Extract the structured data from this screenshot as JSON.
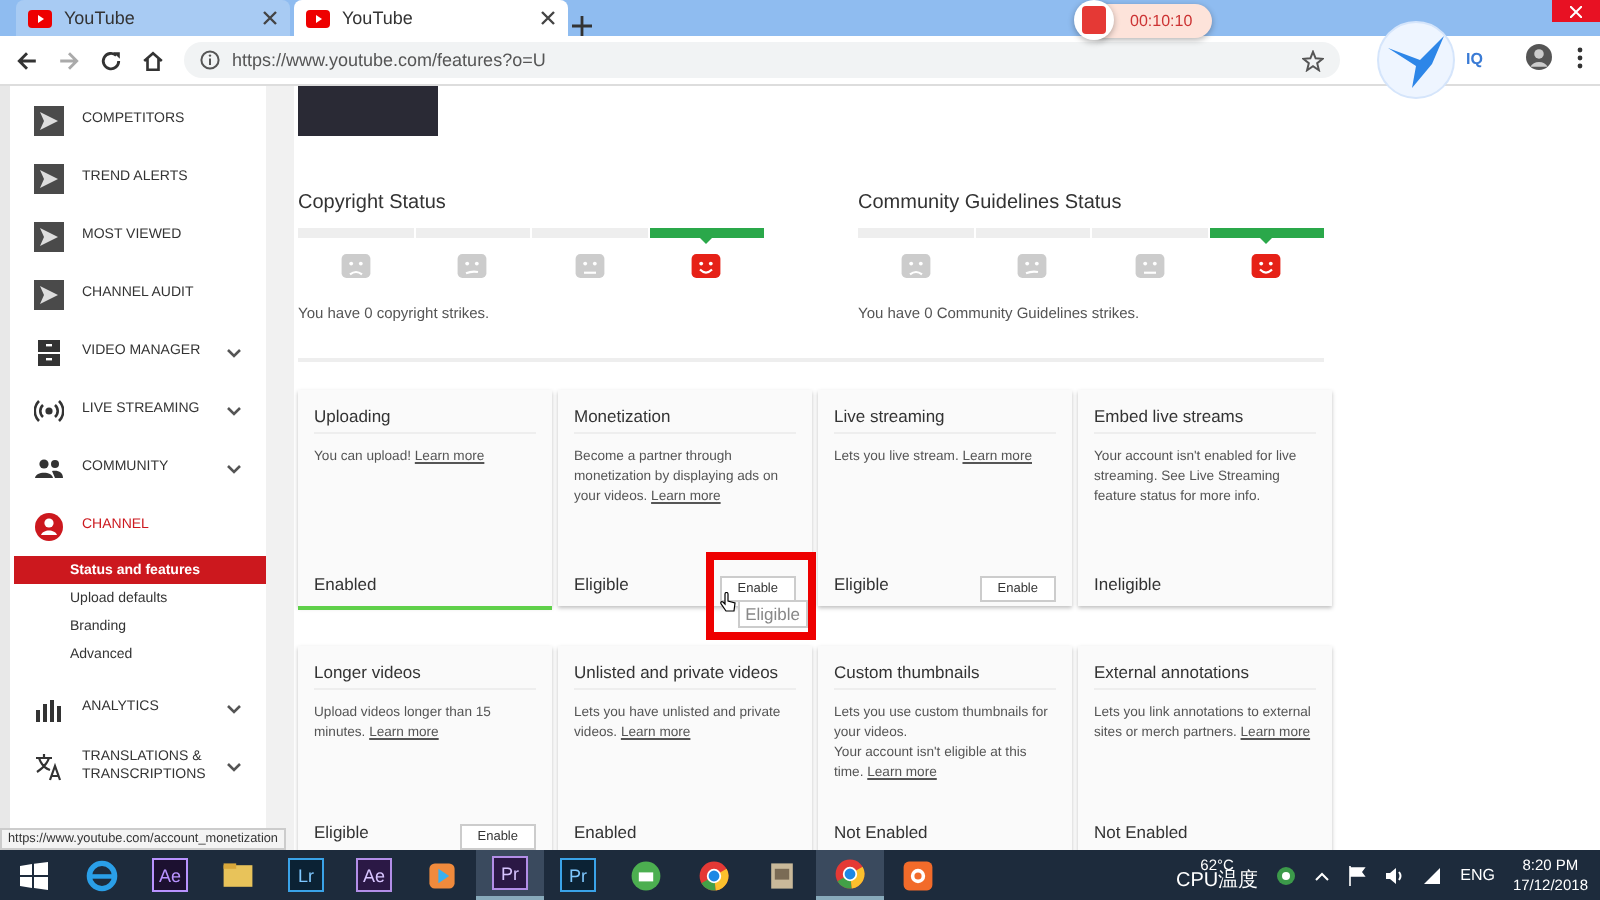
{
  "browser": {
    "tabs": [
      {
        "title": "YouTube",
        "selected": false
      },
      {
        "title": "YouTube",
        "selected": true
      }
    ],
    "url": "https://www.youtube.com/features?o=U",
    "recorder_time": "00:10:10",
    "extension_label": "IQ"
  },
  "sidebar": {
    "items": [
      {
        "kind": "tool",
        "label": "COMPETITORS"
      },
      {
        "kind": "tool",
        "label": "TREND ALERTS"
      },
      {
        "kind": "tool",
        "label": "MOST VIEWED"
      },
      {
        "kind": "tool",
        "label": "CHANNEL AUDIT"
      },
      {
        "kind": "menu",
        "label": "VIDEO MANAGER",
        "expanded": false
      },
      {
        "kind": "menu",
        "label": "LIVE STREAMING",
        "expanded": false
      },
      {
        "kind": "menu",
        "label": "COMMUNITY",
        "expanded": false
      },
      {
        "kind": "menu",
        "label": "CHANNEL",
        "expanded": true,
        "children": [
          {
            "label": "Status and features",
            "selected": true
          },
          {
            "label": "Upload defaults",
            "selected": false
          },
          {
            "label": "Branding",
            "selected": false
          },
          {
            "label": "Advanced",
            "selected": false
          }
        ]
      },
      {
        "kind": "menu",
        "label": "ANALYTICS",
        "expanded": false
      },
      {
        "kind": "menu",
        "label": "TRANSLATIONS & TRANSCRIPTIONS",
        "expanded": false
      }
    ]
  },
  "status": [
    {
      "title": "Copyright Status",
      "meter": [
        {
          "selected": false
        },
        {
          "selected": false
        },
        {
          "selected": false
        },
        {
          "selected": true
        }
      ],
      "text": "You have 0 copyright strikes."
    },
    {
      "title": "Community Guidelines Status",
      "meter": [
        {
          "selected": false
        },
        {
          "selected": false
        },
        {
          "selected": false
        },
        {
          "selected": true
        }
      ],
      "text": "You have 0 Community Guidelines strikes."
    }
  ],
  "features": [
    {
      "title": "Uploading",
      "description": [
        "You can upload!"
      ],
      "link": "Learn more",
      "status": "Enabled",
      "active": true
    },
    {
      "title": "Monetization",
      "description": [
        "Become a partner through monetization by displaying ads on your videos."
      ],
      "link": "Learn more",
      "status": "Eligible",
      "button": "Enable",
      "highlighted": true,
      "tooltip": "Eligible",
      "active": false
    },
    {
      "title": "Live streaming",
      "description": [
        "Lets you live stream."
      ],
      "link": "Learn more",
      "status": "Eligible",
      "button": "Enable",
      "active": false
    },
    {
      "title": "Embed live streams",
      "description": [
        "Your account isn't enabled for live streaming. See Live Streaming feature status for more info."
      ],
      "status": "Ineligible",
      "active": false
    },
    {
      "title": "Longer videos",
      "description": [
        "Upload videos longer than 15 minutes."
      ],
      "link": "Learn more",
      "status": "Eligible",
      "button": "Enable",
      "active": false
    },
    {
      "title": "Unlisted and private videos",
      "description": [
        "Lets you have unlisted and private videos."
      ],
      "link": "Learn more",
      "status": "Enabled",
      "active": false
    },
    {
      "title": "Custom thumbnails",
      "description": [
        "Lets you use custom thumbnails for your videos.",
        "Your account isn't eligible at this time."
      ],
      "link": "Learn more",
      "status": "Not Enabled",
      "active": false
    },
    {
      "title": "External annotations",
      "description": [
        "Lets you link annotations to external sites or merch partners."
      ],
      "link": "Learn more",
      "status": "Not Enabled",
      "active": false
    }
  ],
  "status_url": "https://www.youtube.com/account_monetization",
  "taskbar": {
    "apps": [
      {
        "selected": false
      },
      {
        "label": "Ae",
        "selected": false
      },
      {
        "selected": false
      },
      {
        "label": "Lr",
        "selected": false
      },
      {
        "label": "Ae",
        "selected": false
      },
      {
        "selected": false
      },
      {
        "label": "Pr",
        "selected": true
      },
      {
        "label": "Pr",
        "selected": false
      },
      {
        "selected": false
      },
      {
        "selected": false
      },
      {
        "selected": false
      },
      {
        "selected": true
      },
      {
        "selected": false
      }
    ],
    "temperature": "62°C",
    "sensor": "CPU温度",
    "language": "ENG",
    "time": "8:20 PM",
    "date": "17/12/2018"
  }
}
